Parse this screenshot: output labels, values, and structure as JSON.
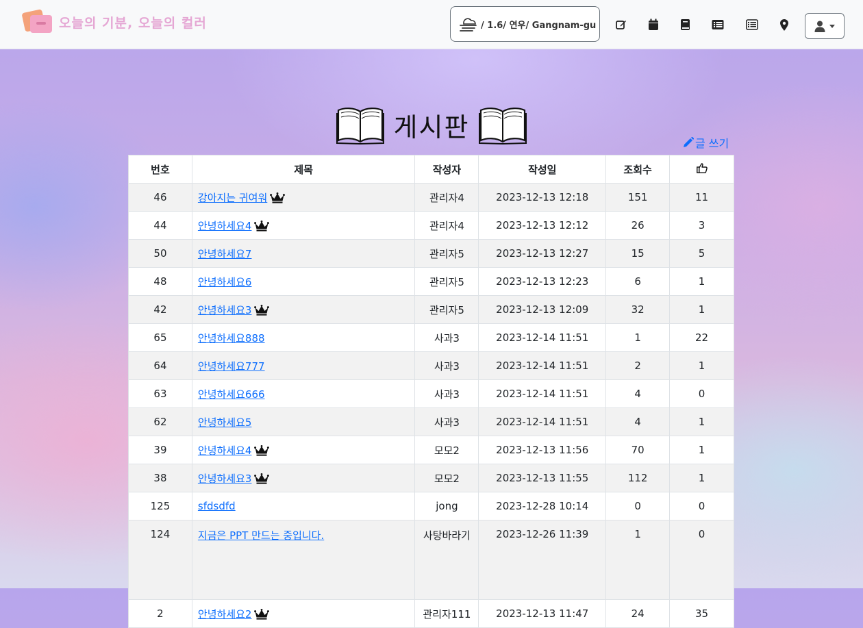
{
  "brand": {
    "title": "오늘의 기분, 오늘의 컬러"
  },
  "weather": {
    "text": "/ 1.6/ 연우/ Gangnam-gu",
    "icon": "fog-cloud-icon"
  },
  "nav": {
    "icons": [
      "edit-icon",
      "calendar-icon",
      "book-icon",
      "list-alt-icon",
      "list-icon",
      "map-marker-icon"
    ],
    "user_icon": "user-icon"
  },
  "board": {
    "title": "게시판",
    "write_label": "글 쓰기",
    "columns": [
      "번호",
      "제목",
      "작성자",
      "작성일",
      "조회수"
    ],
    "likes_column_icon": "thumbs-up-icon",
    "rows": [
      {
        "no": "46",
        "title": "강아지는 귀여워",
        "author": "관리자4",
        "date": "2023-12-13 12:18",
        "views": "151",
        "likes": "11",
        "crown": true
      },
      {
        "no": "44",
        "title": "안녕하세요4",
        "author": "관리자4",
        "date": "2023-12-13 12:12",
        "views": "26",
        "likes": "3",
        "crown": true
      },
      {
        "no": "50",
        "title": "안녕하세요7",
        "author": "관리자5",
        "date": "2023-12-13 12:27",
        "views": "15",
        "likes": "5",
        "crown": false
      },
      {
        "no": "48",
        "title": "안녕하세요6",
        "author": "관리자5",
        "date": "2023-12-13 12:23",
        "views": "6",
        "likes": "1",
        "crown": false
      },
      {
        "no": "42",
        "title": "안녕하세요3",
        "author": "관리자5",
        "date": "2023-12-13 12:09",
        "views": "32",
        "likes": "1",
        "crown": true
      },
      {
        "no": "65",
        "title": "안녕하세요888",
        "author": "사과3",
        "date": "2023-12-14 11:51",
        "views": "1",
        "likes": "22",
        "crown": false
      },
      {
        "no": "64",
        "title": "안녕하세요777",
        "author": "사과3",
        "date": "2023-12-14 11:51",
        "views": "2",
        "likes": "1",
        "crown": false
      },
      {
        "no": "63",
        "title": "안녕하세요666",
        "author": "사과3",
        "date": "2023-12-14 11:51",
        "views": "4",
        "likes": "0",
        "crown": false
      },
      {
        "no": "62",
        "title": "안녕하세요5",
        "author": "사과3",
        "date": "2023-12-14 11:51",
        "views": "4",
        "likes": "1",
        "crown": false
      },
      {
        "no": "39",
        "title": "안녕하세요4",
        "author": "모모2",
        "date": "2023-12-13 11:56",
        "views": "70",
        "likes": "1",
        "crown": true
      },
      {
        "no": "38",
        "title": "안녕하세요3",
        "author": "모모2",
        "date": "2023-12-13 11:55",
        "views": "112",
        "likes": "1",
        "crown": true
      },
      {
        "no": "125",
        "title": "sfdsdfd",
        "author": "jong",
        "date": "2023-12-28 10:14",
        "views": "0",
        "likes": "0",
        "crown": false
      },
      {
        "no": "124",
        "title": "지금은 PPT 만드는 중입니다.",
        "author": "사탕바라기",
        "date": "2023-12-26 11:39",
        "views": "1",
        "likes": "0",
        "crown": false,
        "tall": true
      },
      {
        "no": "2",
        "title": "안녕하세요2",
        "author": "관리자111",
        "date": "2023-12-13 11:47",
        "views": "24",
        "likes": "35",
        "crown": true
      }
    ]
  }
}
